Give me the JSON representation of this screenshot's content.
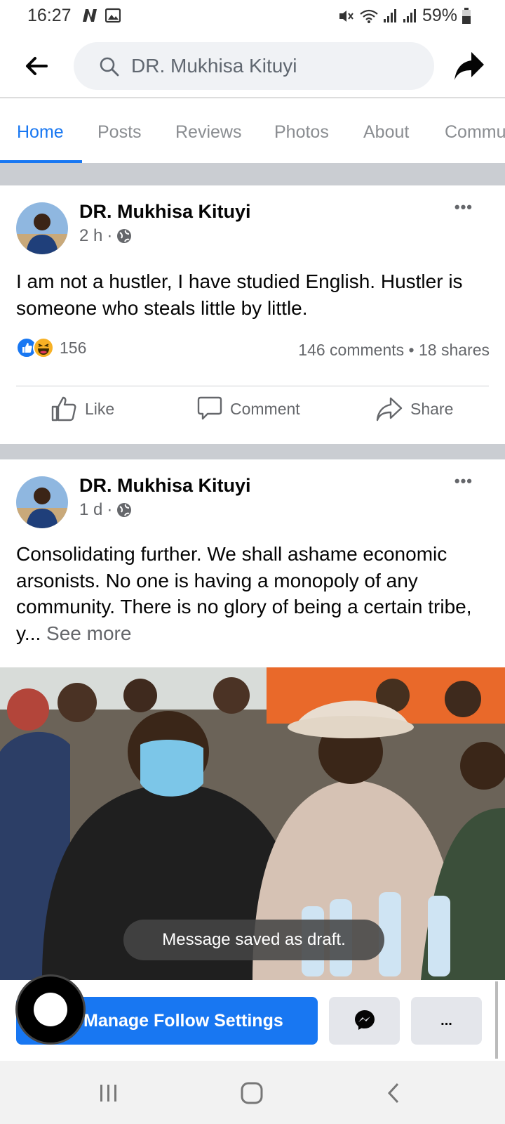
{
  "status_bar": {
    "time": "16:27",
    "battery": "59%"
  },
  "search": {
    "value": "DR. Mukhisa Kituyi",
    "placeholder": "Search"
  },
  "tabs": [
    {
      "label": "Home"
    },
    {
      "label": "Posts"
    },
    {
      "label": "Reviews"
    },
    {
      "label": "Photos"
    },
    {
      "label": "About"
    },
    {
      "label": "Commu"
    }
  ],
  "posts": [
    {
      "author": "DR. Mukhisa Kituyi",
      "time": "2 h",
      "text": "I am not a hustler, I have studied English. Hustler is someone who steals little by little.",
      "reaction_count": "156",
      "comments": "146 comments",
      "shares": "18 shares"
    },
    {
      "author": "DR. Mukhisa Kituyi",
      "time": "1 d",
      "text": "Consolidating further. We shall ashame economic arsonists. No one is having a monopoly of any community. There is no glory of being a certain tribe, y...",
      "see_more": "See more"
    }
  ],
  "actions": {
    "like": "Like",
    "comment": "Comment",
    "share": "Share"
  },
  "toast": "Message saved as draft.",
  "bottom_bar": {
    "manage_label": "Manage Follow Settings",
    "more_label": "..."
  },
  "colors": {
    "accent": "#1877f2",
    "separator": "#cacdd2"
  }
}
